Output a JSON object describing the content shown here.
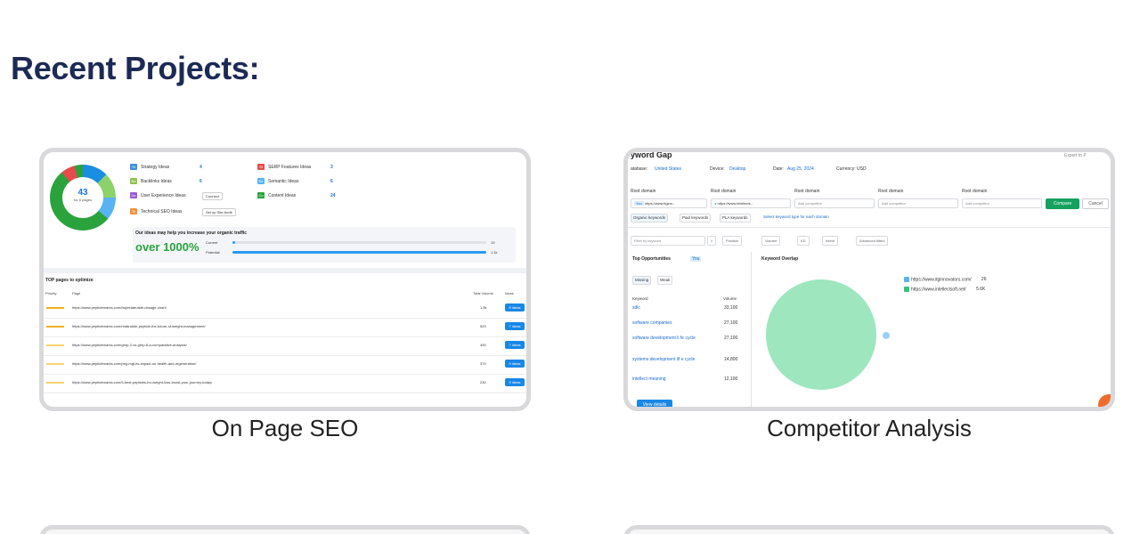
{
  "heading": "Recent Projects:",
  "projects": [
    {
      "caption": "On Page SEO",
      "donut": {
        "value": "43",
        "sub": "for 6 pages"
      },
      "ideas_left": [
        {
          "label": "Strategy Ideas",
          "count": "4",
          "badge": "St",
          "color": "#3e8fe0"
        },
        {
          "label": "Backlinks Ideas",
          "count": "6",
          "badge": "Ba",
          "color": "#8bc34a"
        },
        {
          "label": "User Experience Ideas",
          "count": "",
          "badge": "Ux",
          "color": "#9c5ad1"
        },
        {
          "label": "Technical SEO Ideas",
          "count": "",
          "badge": "Te",
          "color": "#f0923b"
        }
      ],
      "ideas_right": [
        {
          "label": "SERP Features Ideas",
          "count": "3",
          "badge": "Sf",
          "color": "#e74a4a"
        },
        {
          "label": "Semantic Ideas",
          "count": "6",
          "badge": "Se",
          "color": "#57b4f1"
        },
        {
          "label": "Content Ideas",
          "count": "24",
          "badge": "Co",
          "color": "#2aa33d"
        }
      ],
      "connect_label": "Connect",
      "site_audit_label": "Set up Site Audit",
      "traffic_title": "Our ideas may help you increase your organic traffic",
      "traffic_big": "over 1000%",
      "current_label": "Current",
      "current_value": "13",
      "current_pct": 0.01,
      "potential_label": "Potential",
      "potential_value": "1.1k",
      "potential_pct": 1.0,
      "table_title": "TOP pages to optimize",
      "columns": [
        "Priority",
        "Page",
        "Total Volume",
        "Ideas"
      ],
      "rows": [
        {
          "url": "https://www.peptidemarks.com/faq/retatrutide-dosage-chart/",
          "volume": "1.5k",
          "ideas": "5 ideas",
          "priority_color": "#f2b01e"
        },
        {
          "url": "https://www.peptidemarks.com/retatrutide-peptide-the-future-of-weight-management/",
          "volume": "520",
          "ideas": "7 ideas",
          "priority_color": "#f2b01e"
        },
        {
          "url": "https://www.peptidemarks.com/ghrp-2-vs-ghrp-6-a-comparative-analysis/",
          "volume": "490",
          "ideas": "7 ideas",
          "priority_color": "#f7d46b"
        },
        {
          "url": "https://www.peptidemarks.com/peg-mgf-its-impact-on-health-and-regeneration/",
          "volume": "370",
          "ideas": "9 ideas",
          "priority_color": "#f7d46b"
        },
        {
          "url": "https://www.peptidemarks.com/5-best-peptides-for-weight-loss-boost-your-journey-today/",
          "volume": "230",
          "ideas": "9 ideas",
          "priority_color": "#f7d46b"
        }
      ]
    },
    {
      "caption": "Competitor Analysis",
      "title": "yword Gap",
      "export_label": "Export to P",
      "database_label": "atabase:",
      "database_value": "United States",
      "device_label": "Device:",
      "device_value": "Desktop",
      "date_label": "Date:",
      "date_value": "Aug 25, 2024",
      "currency": "Currency: USD",
      "root_domain_label": "Root domain",
      "you_badge": "You",
      "domain1": "https://www.itginn...",
      "domain2": "https://www.intellects...",
      "add_competitor": "Add competitor",
      "compare_label": "Compare",
      "cancel_label": "Cancel",
      "tabs": [
        "Organic keywords",
        "Paid keywords",
        "PLA keywords"
      ],
      "tab_hint": "Select keyword type for each domain",
      "filter_placeholder": "Filter by keyword",
      "filters": [
        "Position",
        "Volume",
        "KD",
        "Intent",
        "Advanced filters"
      ],
      "top_opps": "Top Opportunities",
      "top_you": "You",
      "missing": "Missing",
      "weak": "Weak",
      "kw_col": "Keyword",
      "vol_col": "Volume",
      "keywords": [
        {
          "kw": "sdlc",
          "vol": "33,100"
        },
        {
          "kw": "software companies",
          "vol": "27,100"
        },
        {
          "kw": "software development li fe cycle",
          "vol": "27,100"
        },
        {
          "kw": "systems development lif e cycle",
          "vol": "14,800"
        },
        {
          "kw": "intellect meaning",
          "vol": "12,100"
        }
      ],
      "view_details": "View details",
      "overlap_title": "Keyword Overlap",
      "legend": [
        {
          "site": "https://www.itginnovators.com/",
          "value": "26"
        },
        {
          "site": "https://www.intellectsoft.net/",
          "value": "5.6K"
        }
      ]
    }
  ]
}
